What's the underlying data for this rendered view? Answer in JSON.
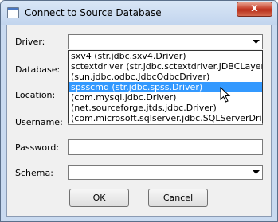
{
  "window": {
    "title": "Connect to Source Database",
    "close_glyph": "x"
  },
  "form": {
    "driver_label": "Driver:",
    "database_label": "Database:",
    "location_label": "Location:",
    "username_label": "Username:",
    "password_label": "Password:",
    "schema_label": "Schema:",
    "driver_value": "",
    "password_value": "",
    "schema_value": ""
  },
  "driver_dropdown": {
    "selected_index": 3,
    "options": [
      "sxv4  (str.jdbc.sxv4.Driver)",
      "sctextdriver  (str.jdbc.sctextdriver.JDBCLayer.SCTextDriver)",
      "(sun.jdbc.odbc.JdbcOdbcDriver)",
      "spsscmd  (str.jdbc.spss.Driver)",
      "(com.mysql.jdbc.Driver)",
      "(net.sourceforge.jtds.jdbc.Driver)",
      "(com.microsoft.sqlserver.jdbc.SQLServerDriver)"
    ]
  },
  "buttons": {
    "ok": "OK",
    "cancel": "Cancel"
  },
  "icons": {
    "app": "window-app-icon",
    "close": "close-icon",
    "dropdown": "chevron-down-icon",
    "cursor": "mouse-pointer-icon"
  }
}
